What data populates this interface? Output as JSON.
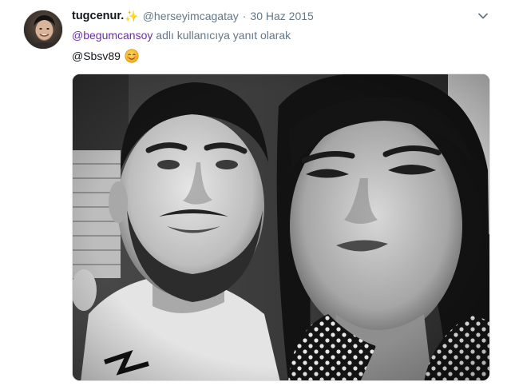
{
  "tweet": {
    "display_name": "tugcenur.",
    "name_emoji": "✨",
    "handle": "@herseyimcagatay",
    "separator": "·",
    "date": "30 Haz 2015",
    "reply_context": {
      "mention": "@begumcansoy",
      "suffix": " adlı kullanıcıya yanıt olarak"
    },
    "text_mention": "@Sbsv89",
    "text_emoji": "smiling-face-emoji"
  },
  "icons": {
    "menu": "chevron-down-icon"
  },
  "colors": {
    "mention": "#6a2fa8",
    "muted": "#657786",
    "text": "#14171a"
  }
}
